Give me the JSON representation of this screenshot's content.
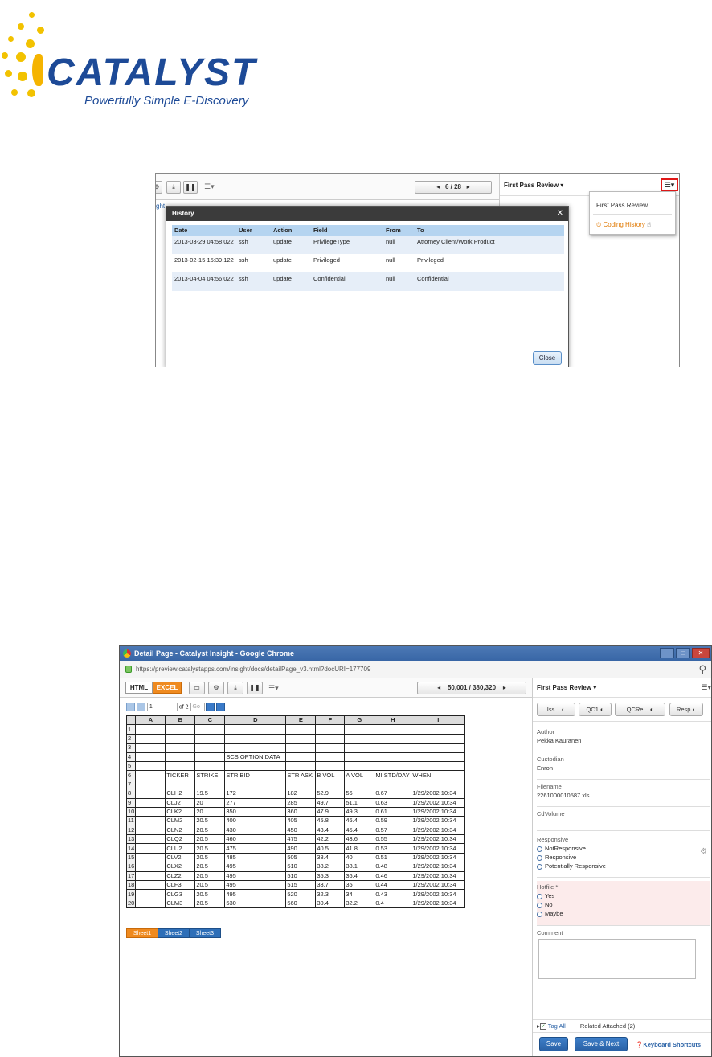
{
  "logo": {
    "name": "CATALYST",
    "tagline": "Powerfully Simple E-Discovery"
  },
  "screen1": {
    "pager": "6 / 28",
    "panel_title": "First Pass Review",
    "left_fragment": "ght",
    "dropdown": {
      "item1": "First Pass Review",
      "item2": "Coding History"
    },
    "history": {
      "title": "History",
      "headers": [
        "Date",
        "User",
        "Action",
        "Field",
        "From",
        "To"
      ],
      "rows": [
        [
          "2013-03-29 04:58:022",
          "ssh",
          "update",
          "PrivilegeType",
          "null",
          "Attorney Client/Work Product"
        ],
        [
          "2013-02-15 15:39:122",
          "ssh",
          "update",
          "Privileged",
          "null",
          "Privileged"
        ],
        [
          "2013-04-04 04:56:022",
          "ssh",
          "update",
          "Confidential",
          "null",
          "Confidential"
        ]
      ],
      "close": "Close"
    }
  },
  "screen2": {
    "window_title": "Detail Page - Catalyst Insight - Google Chrome",
    "url": "https://preview.catalystapps.com/insight/docs/detailPage_v3.html?docURI=177709",
    "tab_html": "HTML",
    "tab_excel": "EXCEL",
    "pager": "50,001 / 380,320",
    "sheet_page": "1",
    "sheet_of": "of 2",
    "go": "Go",
    "columns": [
      "A",
      "B",
      "C",
      "D",
      "E",
      "F",
      "G",
      "H",
      "I"
    ],
    "rows": [
      [
        "1",
        "",
        "",
        "",
        "",
        "",
        "",
        "",
        ""
      ],
      [
        "2",
        "",
        "",
        "",
        "",
        "",
        "",
        "",
        ""
      ],
      [
        "3",
        "",
        "",
        "",
        "",
        "",
        "",
        "",
        ""
      ],
      [
        "4",
        "",
        "",
        "",
        "SCS OPTION DATA",
        "",
        "",
        "",
        ""
      ],
      [
        "5",
        "",
        "",
        "",
        "",
        "",
        "",
        "",
        ""
      ],
      [
        "6",
        "",
        "TICKER",
        "STRIKE",
        "STR BID",
        "STR ASK",
        "B VOL",
        "A VOL",
        "MI STD/DAY",
        "WHEN"
      ],
      [
        "7",
        "",
        "",
        "",
        "",
        "",
        "",
        "",
        ""
      ],
      [
        "8",
        "",
        "CLH2",
        "19.5",
        "172",
        "182",
        "52.9",
        "56",
        "0.67",
        "1/29/2002 10:34"
      ],
      [
        "9",
        "",
        "CLJ2",
        "20",
        "277",
        "285",
        "49.7",
        "51.1",
        "0.63",
        "1/29/2002 10:34"
      ],
      [
        "10",
        "",
        "CLK2",
        "20",
        "350",
        "360",
        "47.9",
        "49.3",
        "0.61",
        "1/29/2002 10:34"
      ],
      [
        "11",
        "",
        "CLM2",
        "20.5",
        "400",
        "405",
        "45.8",
        "46.4",
        "0.59",
        "1/29/2002 10:34"
      ],
      [
        "12",
        "",
        "CLN2",
        "20.5",
        "430",
        "450",
        "43.4",
        "45.4",
        "0.57",
        "1/29/2002 10:34"
      ],
      [
        "13",
        "",
        "CLQ2",
        "20.5",
        "460",
        "475",
        "42.2",
        "43.6",
        "0.55",
        "1/29/2002 10:34"
      ],
      [
        "14",
        "",
        "CLU2",
        "20.5",
        "475",
        "490",
        "40.5",
        "41.8",
        "0.53",
        "1/29/2002 10:34"
      ],
      [
        "15",
        "",
        "CLV2",
        "20.5",
        "485",
        "505",
        "38.4",
        "40",
        "0.51",
        "1/29/2002 10:34"
      ],
      [
        "16",
        "",
        "CLX2",
        "20.5",
        "495",
        "510",
        "38.2",
        "38.1",
        "0.48",
        "1/29/2002 10:34"
      ],
      [
        "17",
        "",
        "CLZ2",
        "20.5",
        "495",
        "510",
        "35.3",
        "36.4",
        "0.46",
        "1/29/2002 10:34"
      ],
      [
        "18",
        "",
        "CLF3",
        "20.5",
        "495",
        "515",
        "33.7",
        "35",
        "0.44",
        "1/29/2002 10:34"
      ],
      [
        "19",
        "",
        "CLG3",
        "20.5",
        "495",
        "520",
        "32.3",
        "34",
        "0.43",
        "1/29/2002 10:34"
      ],
      [
        "20",
        "",
        "CLM3",
        "20.5",
        "530",
        "560",
        "30.4",
        "32.2",
        "0.4",
        "1/29/2002 10:34"
      ]
    ],
    "sheets": [
      "Sheet1",
      "Sheet2",
      "Sheet3"
    ],
    "panel_title": "First Pass Review",
    "tag_buttons": [
      "Iss...",
      "QC1",
      "QCRe...",
      "Resp"
    ],
    "author_label": "Author",
    "author": "Pekka Kauranen",
    "custodian_label": "Custodian",
    "custodian": "Enron",
    "filename_label": "Filename",
    "filename": "2261000010587.xls",
    "cdvolume_label": "CdVolume",
    "responsive_label": "Responsive",
    "responsive_opts": [
      "NotResponsive",
      "Responsive",
      "Potentially Responsive"
    ],
    "hotfile_label": "Hotfile *",
    "hotfile_opts": [
      "Yes",
      "No",
      "Maybe"
    ],
    "comment_label": "Comment",
    "tag_all": "Tag All",
    "related": "Related Attached (2)",
    "save": "Save",
    "save_next": "Save & Next",
    "shortcuts": "Keyboard Shortcuts"
  }
}
